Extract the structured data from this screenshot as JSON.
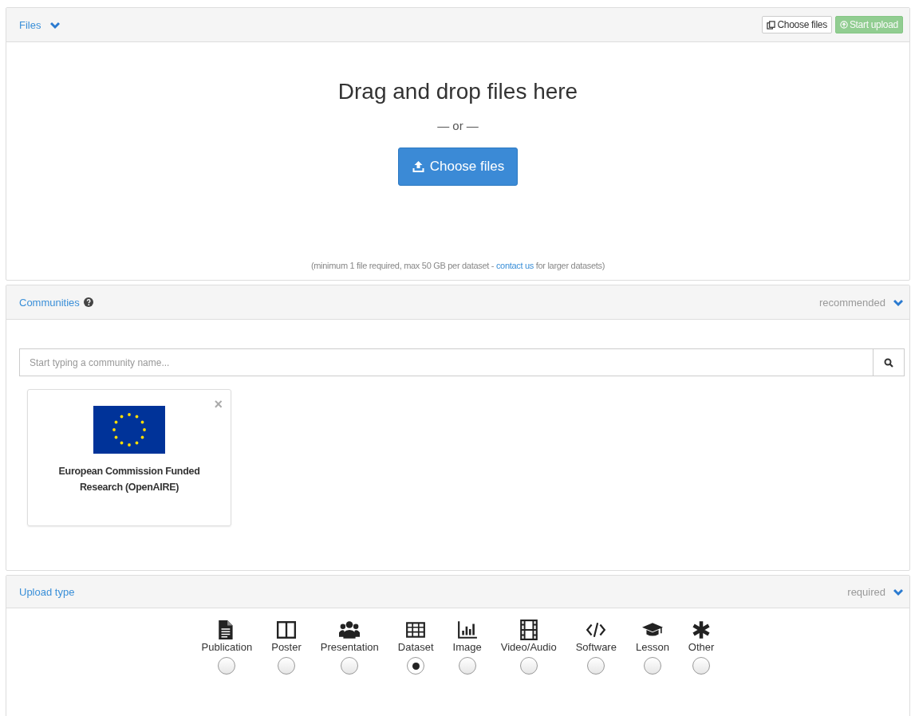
{
  "files": {
    "title": "Files",
    "choose_button": "Choose files",
    "upload_button": "Start upload",
    "upload_disabled": true,
    "drop_title": "Drag and drop files here",
    "or_text": "— or —",
    "big_button": "Choose files",
    "note_before": "(minimum 1 file required, max 50 GB per dataset - ",
    "note_link": "contact us",
    "note_after": " for larger datasets)"
  },
  "communities": {
    "title": "Communities",
    "badge": "recommended",
    "search": {
      "placeholder": "Start typing a community name..."
    },
    "cards": [
      {
        "name": "European Commission Funded Research (OpenAIRE)",
        "close": "×"
      }
    ]
  },
  "upload_type": {
    "title": "Upload type",
    "badge": "required",
    "types": [
      {
        "label": "Publication",
        "selected": false
      },
      {
        "label": "Poster",
        "selected": false
      },
      {
        "label": "Presentation",
        "selected": false
      },
      {
        "label": "Dataset",
        "selected": true
      },
      {
        "label": "Image",
        "selected": false
      },
      {
        "label": "Video/Audio",
        "selected": false
      },
      {
        "label": "Software",
        "selected": false
      },
      {
        "label": "Lesson",
        "selected": false
      },
      {
        "label": "Other",
        "selected": false
      }
    ]
  }
}
